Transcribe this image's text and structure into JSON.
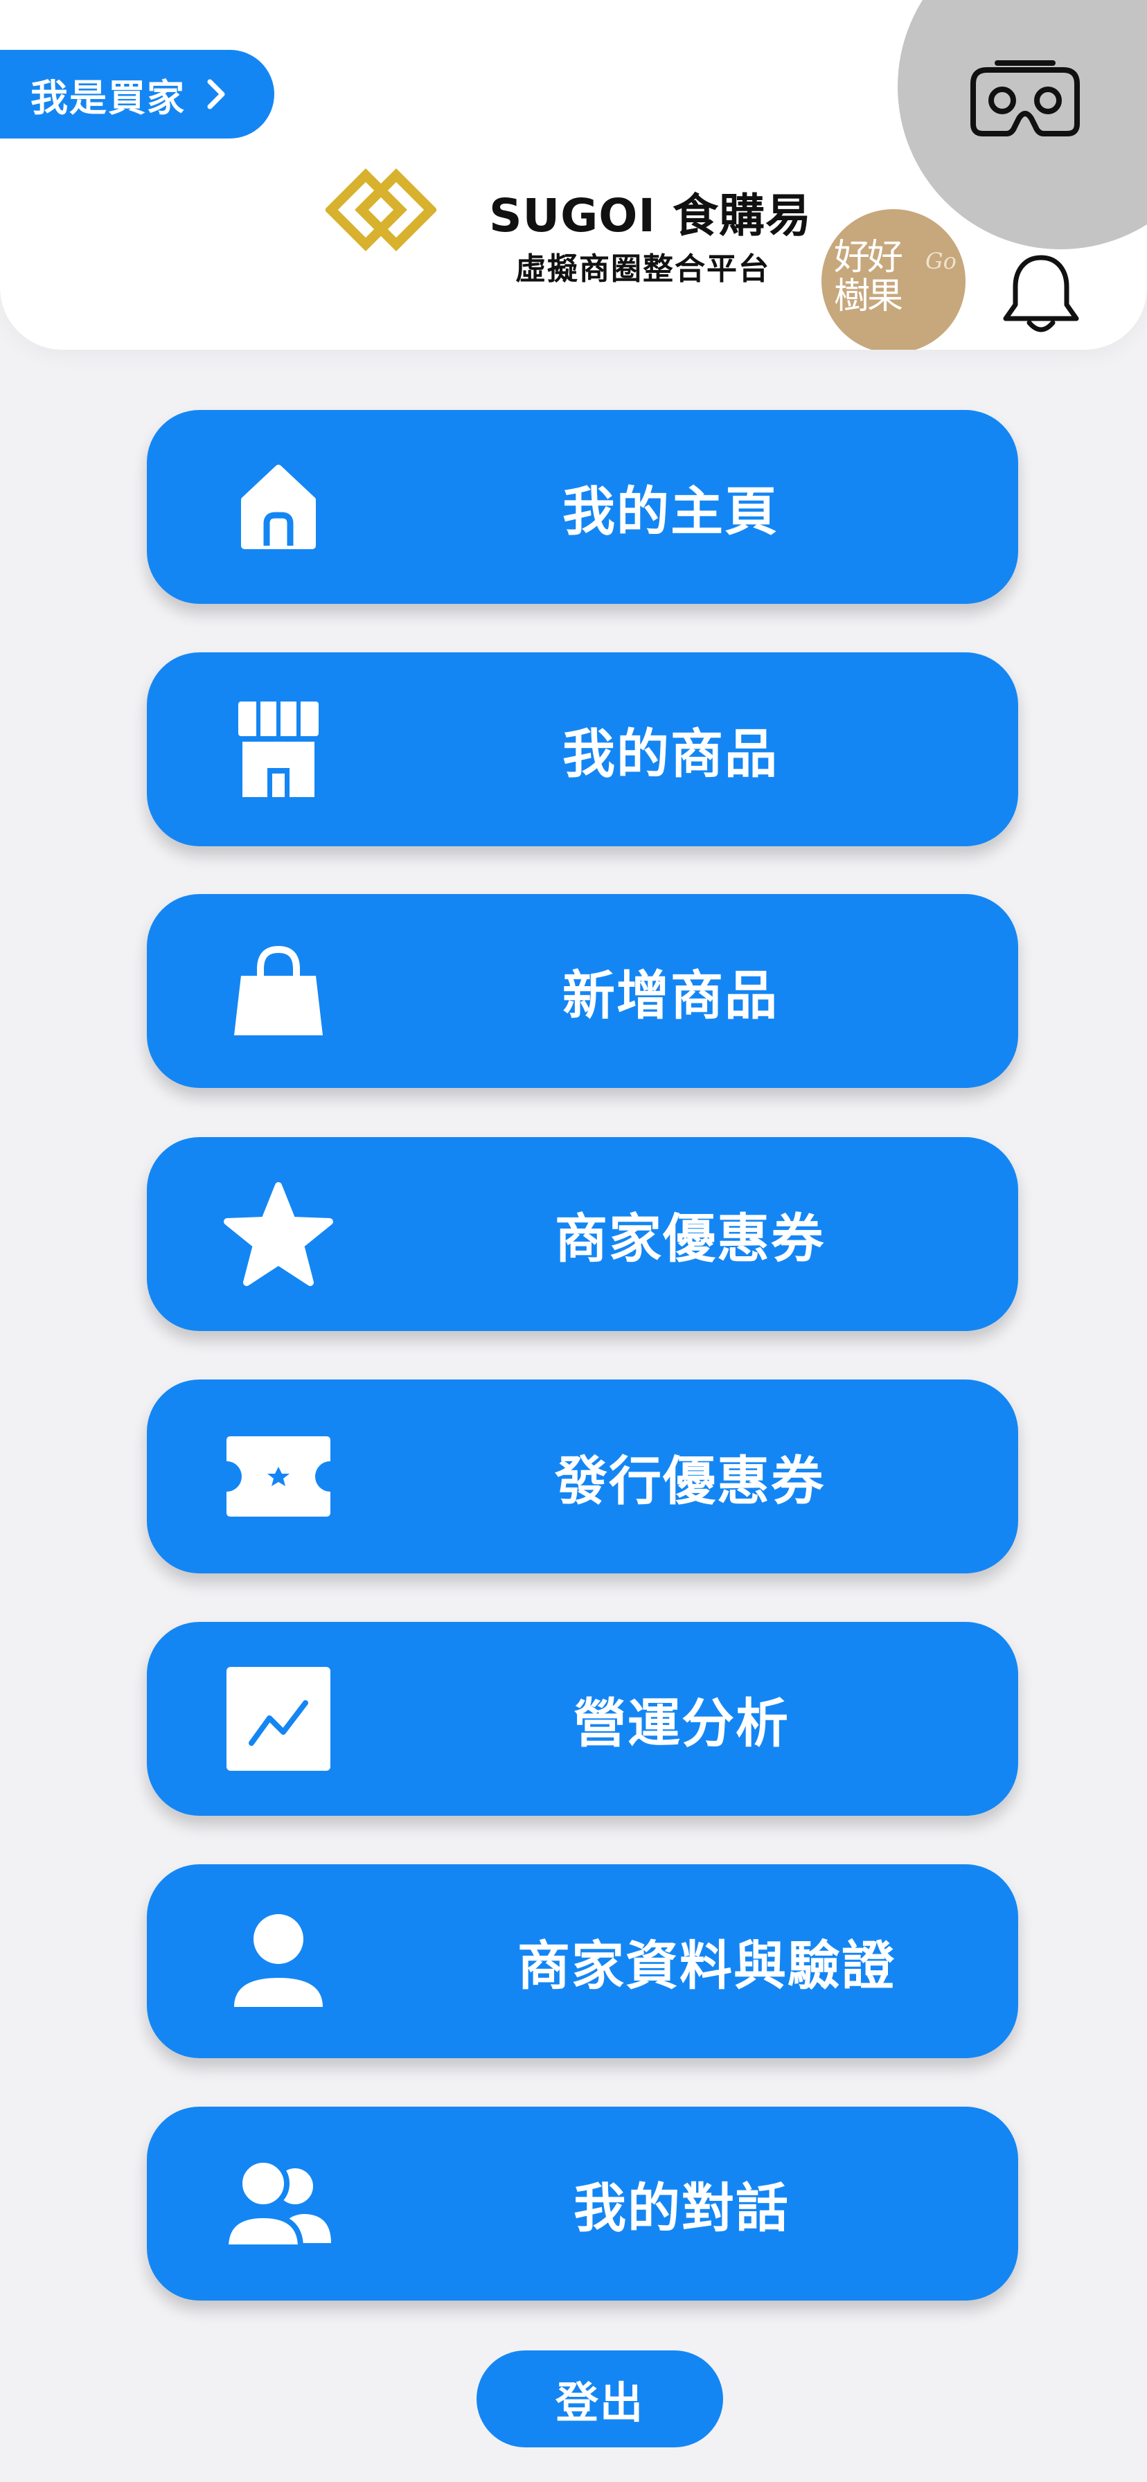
{
  "header": {
    "buyer_button_label": "我是買家",
    "brand_title": "SUGOI 食購易",
    "brand_subtitle": "虛擬商圈整合平台",
    "shop_avatar_text": [
      "好好",
      "樹果",
      "Go"
    ],
    "icons": {
      "buyer_chevron": "chevron-right-icon",
      "vr": "vr-headset-icon",
      "logo": "diamond-logo",
      "notification": "bell-icon"
    }
  },
  "menu": [
    {
      "label": "我的主頁",
      "icon": "home-icon"
    },
    {
      "label": "我的商品",
      "icon": "store-icon"
    },
    {
      "label": "新增商品",
      "icon": "shopping-bag-icon"
    },
    {
      "label": "商家優惠券",
      "icon": "star-icon"
    },
    {
      "label": "發行優惠券",
      "icon": "ticket-icon"
    },
    {
      "label": "營運分析",
      "icon": "chart-icon"
    },
    {
      "label": "商家資料與驗證",
      "icon": "user-icon"
    },
    {
      "label": "我的對話",
      "icon": "users-icon"
    }
  ],
  "logout_label": "登出",
  "colors": {
    "primary": "#1486f4",
    "background": "#f2f2f5",
    "header_bg": "#ffffff",
    "vr_circle": "#c4c4c4",
    "logo_gold": "#d8b22e"
  }
}
